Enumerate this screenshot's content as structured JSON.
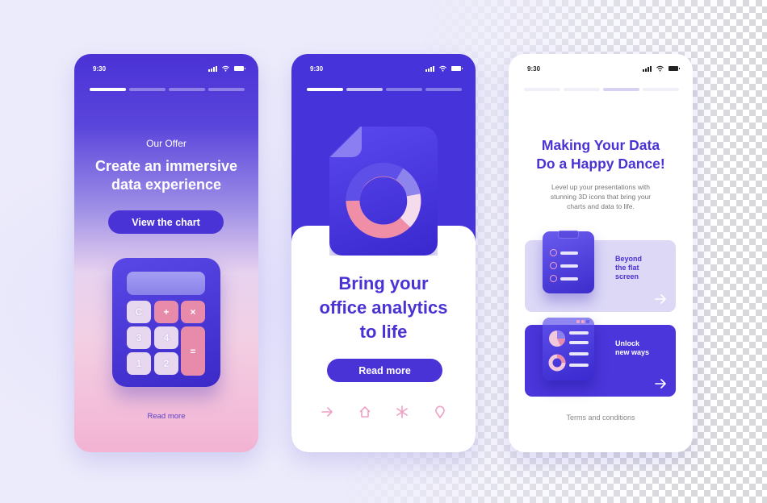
{
  "screens": [
    {
      "name": "offer",
      "status": {
        "time": "9:30"
      },
      "progress": {
        "total": 4,
        "current": 1
      },
      "eyebrow": "Our Offer",
      "title_line1": "Create an immersive",
      "title_line2": "data experience",
      "cta_label": "View the chart",
      "calculator_keys": [
        "C",
        "+",
        "×",
        "3",
        "4",
        "=",
        "1",
        "2"
      ],
      "link_label": "Read more"
    },
    {
      "name": "analytics",
      "status": {
        "time": "9:30"
      },
      "progress": {
        "total": 4,
        "current": 2
      },
      "title_line1": "Bring your",
      "title_line2": "office analytics",
      "title_line3": "to life",
      "cta_label": "Read more",
      "nav_icons": [
        "arrow-right-icon",
        "home-icon",
        "asterisk-icon",
        "location-pin-icon"
      ]
    },
    {
      "name": "features",
      "status": {
        "time": "9:30"
      },
      "progress": {
        "total": 4,
        "current": 3
      },
      "title_line1": "Making Your Data",
      "title_line2": "Do a Happy Dance!",
      "subtitle_line1": "Level up your presentations with",
      "subtitle_line2": "stunning 3D icons that bring your",
      "subtitle_line3": "charts and data to life.",
      "cards": [
        {
          "line1": "Beyond",
          "line2": "the flat",
          "line3": "screen",
          "icon": "checklist-clipboard-icon"
        },
        {
          "line1": "Unlock",
          "line2": "new ways",
          "line3": "",
          "icon": "dashboard-report-icon"
        }
      ],
      "footer_link": "Terms and conditions"
    }
  ],
  "colors": {
    "primary": "#4933d6",
    "pink_accent": "#e88aaa",
    "card_light": "#dcd8f6",
    "muted_text": "#888888"
  }
}
